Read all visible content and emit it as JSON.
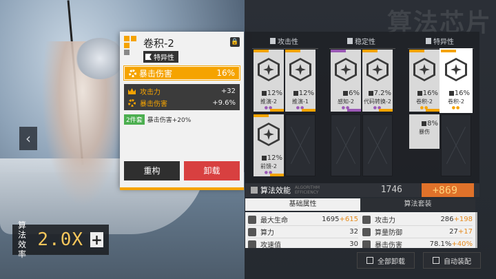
{
  "watermark": "算法芯片",
  "efficiency": {
    "label": "算法效率",
    "value": "2.0X",
    "plus": "+"
  },
  "card": {
    "title": "卷积-2",
    "tag": "特异性",
    "main_stat": {
      "name": "暴击伤害",
      "value": "16%"
    },
    "sub_stats": [
      {
        "name": "攻击力",
        "value": "+32",
        "icon": "crown-icon"
      },
      {
        "name": "暴击伤害",
        "value": "+9.6%",
        "icon": "gear-icon"
      }
    ],
    "set_bonus": {
      "badge": "2件套",
      "text": "暴击伤害+20%"
    },
    "buttons": {
      "restructure": "重构",
      "unload": "卸载"
    }
  },
  "columns": [
    {
      "label": "攻击性"
    },
    {
      "label": "稳定性"
    },
    {
      "label": "特异性"
    }
  ],
  "chips": [
    {
      "pct": "12%",
      "name": "推演-2",
      "color": "#f5a300",
      "dots": "●●"
    },
    {
      "pct": "12%",
      "name": "推演-1",
      "color": "#f5a300",
      "dots": "●●"
    },
    {
      "pct": "6%",
      "name": "感知-2",
      "color": "#9b59b6",
      "dots": "●●"
    },
    {
      "pct": "7.2%",
      "name": "代码转换-2",
      "color": "#f5a300",
      "dots": "●●"
    },
    {
      "pct": "16%",
      "name": "卷积-2",
      "color": "#f5a300",
      "dots": "●●"
    },
    {
      "pct": "16%",
      "name": "卷积-2",
      "color": "#f5a300",
      "dots": "●●"
    },
    {
      "pct": "12%",
      "name": "前馈-2",
      "color": "#f5a300",
      "dots": "●●"
    },
    {
      "pct": "8%",
      "name": "暴伤",
      "color": "#f5a300",
      "dots": ""
    }
  ],
  "eff_bar": {
    "title": "算法效能",
    "sub": "ALGORITHM EFFICIENCY",
    "value": "1746",
    "bonus": "+869"
  },
  "tabs": {
    "basic": "基础属性",
    "set": "算法套装"
  },
  "attributes": [
    {
      "name": "最大生命",
      "value": "1695",
      "bonus": "+615"
    },
    {
      "name": "攻击力",
      "value": "286",
      "bonus": "+198"
    },
    {
      "name": "算力",
      "value": "32",
      "bonus": ""
    },
    {
      "name": "算量防御",
      "value": "27",
      "bonus": "+17"
    },
    {
      "name": "攻速值",
      "value": "30",
      "bonus": ""
    },
    {
      "name": "暴击伤害",
      "value": "78.1%",
      "bonus": "+40%"
    }
  ],
  "bottom": {
    "unload_all": "全部卸载",
    "auto_equip": "自动装配"
  }
}
